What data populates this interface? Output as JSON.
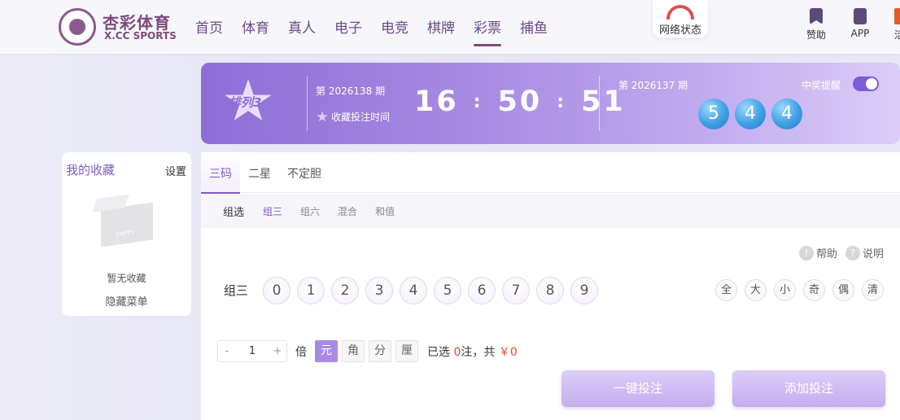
{
  "header": {
    "logo_cn": "杏彩体育",
    "logo_en": "X.CC SPORTS",
    "nav": [
      "首页",
      "体育",
      "真人",
      "电子",
      "电竞",
      "棋牌",
      "彩票",
      "捕鱼"
    ],
    "nav_active_index": 6,
    "network_status": "网络状态",
    "sponsor_label": "赞助",
    "app_label": "APP",
    "extra_label": "活"
  },
  "banner": {
    "lottery_name": "排列3",
    "current_period": "第 2026138 期",
    "fav_time_label": "收藏投注时间",
    "countdown": [
      "16",
      "50",
      "51"
    ],
    "countdown_sep": ":",
    "last_period": "第 2026137 期",
    "last_result": [
      "5",
      "4",
      "4"
    ],
    "win_alert_label": "中奖提醒",
    "win_alert_on": true
  },
  "favorites": {
    "title": "我的收藏",
    "settings": "设置",
    "empty_text": "暂无收藏",
    "hide_menu": "隐藏菜单"
  },
  "tabs": [
    "三码",
    "二星",
    "不定胆"
  ],
  "subtabs": [
    "组选",
    "组三",
    "组六",
    "混合",
    "和值"
  ],
  "help": "帮助",
  "explain": "说明",
  "row_label": "组三",
  "numbers": [
    "0",
    "1",
    "2",
    "3",
    "4",
    "5",
    "6",
    "7",
    "8",
    "9"
  ],
  "quick_select": [
    "全",
    "大",
    "小",
    "奇",
    "偶",
    "清"
  ],
  "bet": {
    "minus": "-",
    "multiplier": "1",
    "plus": "+",
    "times_label": "倍",
    "units": [
      "元",
      "角",
      "分",
      "厘"
    ],
    "active_unit_index": 0,
    "selected_prefix": "已选",
    "selected_count": "0",
    "selected_mid": "注，共",
    "total": "￥0"
  },
  "buttons": {
    "quick_bet": "一键投注",
    "add_bet": "添加投注"
  }
}
